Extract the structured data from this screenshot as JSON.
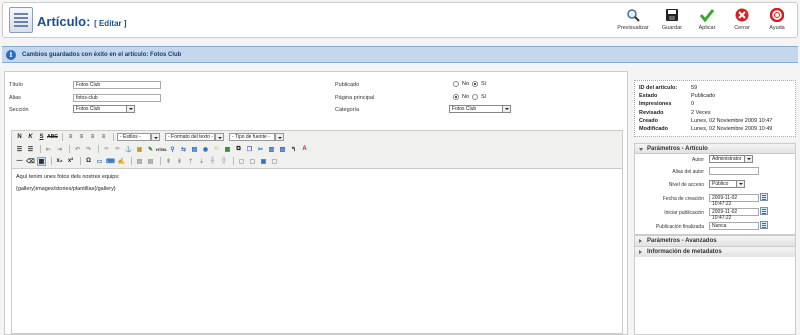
{
  "header": {
    "title": "Artículo:",
    "subtitle": "[ Editar ]",
    "toolbar": [
      {
        "label": "Previsualizar",
        "icon": "magnifier-icon"
      },
      {
        "label": "Guardar",
        "icon": "save-icon"
      },
      {
        "label": "Aplicar",
        "icon": "check-icon"
      },
      {
        "label": "Cerrar",
        "icon": "close-icon"
      },
      {
        "label": "Ayuda",
        "icon": "help-icon"
      }
    ]
  },
  "message": "Cambios guardados con éxito en el artículo: Fotos Club",
  "form": {
    "titulo_label": "Título",
    "titulo_value": "Fotos Club",
    "alias_label": "Alias",
    "alias_value": "fotos-club",
    "seccion_label": "Sección",
    "seccion_value": "Fotos Club",
    "publicado_label": "Publicado",
    "pagina_label": "Página principal",
    "categoria_label": "Categoría",
    "categoria_value": "Fotos Club",
    "no_label": "No",
    "si_label": "Sí"
  },
  "editor": {
    "dropdowns": [
      "- Estilos -",
      "- Formato del texto -",
      "- Tipo de fuente -"
    ],
    "line1": "Aquí tenim unes fotos dels nostres equips:",
    "line2": "{gallery}images/stories/plantillas{/gallery}"
  },
  "info": {
    "rows": [
      {
        "k": "ID del artículo:",
        "v": "59"
      },
      {
        "k": "Estado",
        "v": "Publicado"
      },
      {
        "k": "Impresiones",
        "v": "0"
      },
      {
        "k": "Revisado",
        "v": "2 Veces"
      },
      {
        "k": "Creado",
        "v": "Lunes, 02 Noviembre 2009 10:47"
      },
      {
        "k": "Modificado",
        "v": "Lunes, 02 Noviembre 2009 10:49"
      }
    ]
  },
  "params": {
    "title": "Parámetros - Artículo",
    "autor_label": "Autor",
    "autor_value": "Administrator",
    "alias_autor_label": "Alias del autor",
    "nivel_label": "Nivel de acceso",
    "nivel_value": "Público",
    "fecha_label": "Fecha de creación",
    "fecha_value": "2009-11-02 10:47:22",
    "inicio_label": "Iniciar publicación",
    "inicio_value": "2009-11-02 10:47:22",
    "fin_label": "Publicación finalizada",
    "fin_value": "Nunca"
  },
  "advanced_title": "Parámetros - Avanzados",
  "meta_title": "Información de metadatos"
}
